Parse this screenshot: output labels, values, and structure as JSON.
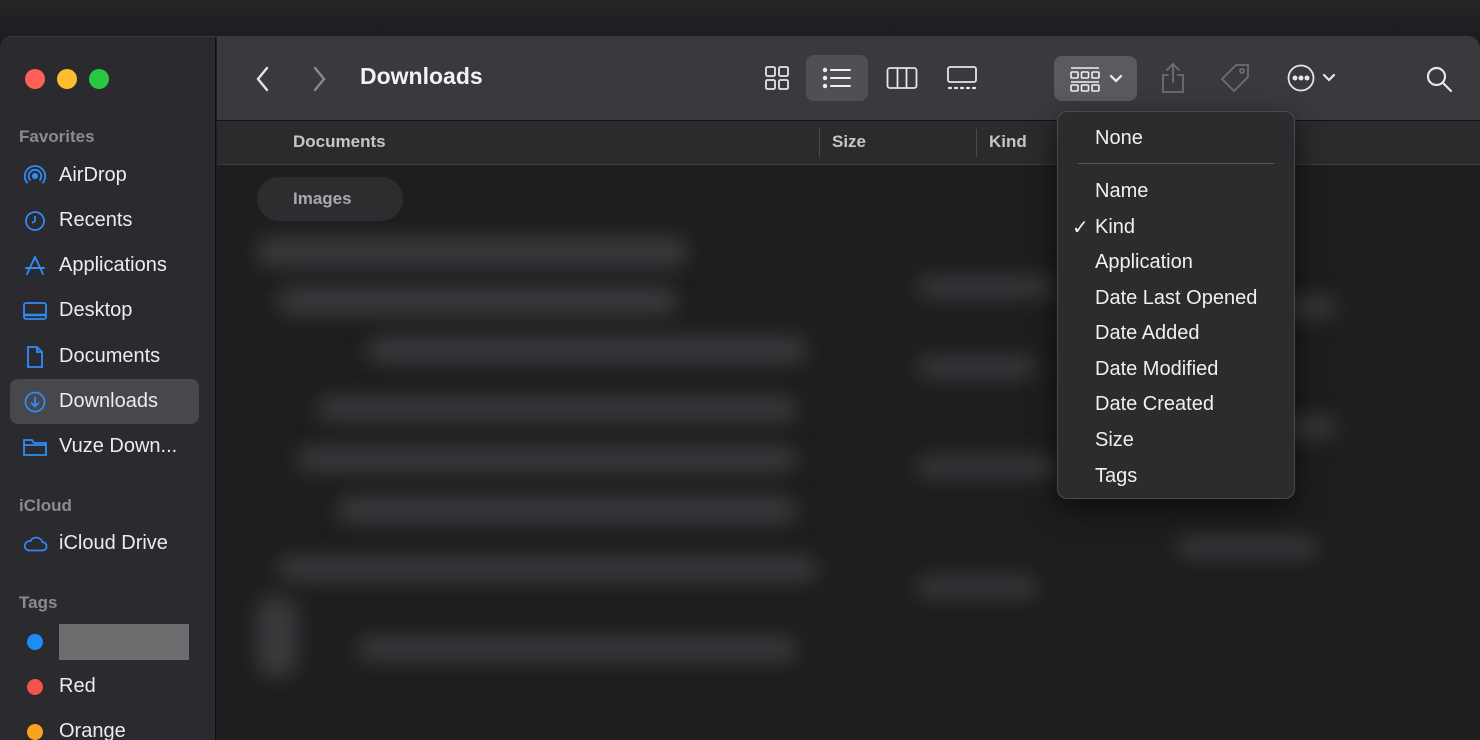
{
  "toolbar": {
    "title": "Downloads"
  },
  "sidebar": {
    "favorites_label": "Favorites",
    "items": [
      {
        "label": "AirDrop",
        "icon": "airdrop-icon"
      },
      {
        "label": "Recents",
        "icon": "clock-icon"
      },
      {
        "label": "Applications",
        "icon": "applications-icon"
      },
      {
        "label": "Desktop",
        "icon": "desktop-icon"
      },
      {
        "label": "Documents",
        "icon": "document-icon"
      },
      {
        "label": "Downloads",
        "icon": "download-icon",
        "active": true
      },
      {
        "label": "Vuze Down...",
        "icon": "folder-icon"
      }
    ],
    "icloud_label": "iCloud",
    "icloud_items": [
      {
        "label": "iCloud Drive",
        "icon": "cloud-icon"
      }
    ],
    "tags_label": "Tags",
    "tags": [
      {
        "label": "",
        "color": "#1e8cf7",
        "redacted": true
      },
      {
        "label": "Red",
        "color": "#f0544d"
      },
      {
        "label": "Orange",
        "color": "#f7a320"
      }
    ]
  },
  "columns": {
    "name": "Documents",
    "size": "Size",
    "kind": "Kind"
  },
  "group": {
    "label": "Images"
  },
  "group_menu": {
    "items": [
      "None",
      "Name",
      "Kind",
      "Application",
      "Date Last Opened",
      "Date Added",
      "Date Modified",
      "Date Created",
      "Size",
      "Tags"
    ],
    "checked": "Kind"
  },
  "colors": {
    "accent": "#2f8cf5",
    "sidebar_bg": "#2a2a2f",
    "toolbar_bg": "#3a3a3e"
  }
}
